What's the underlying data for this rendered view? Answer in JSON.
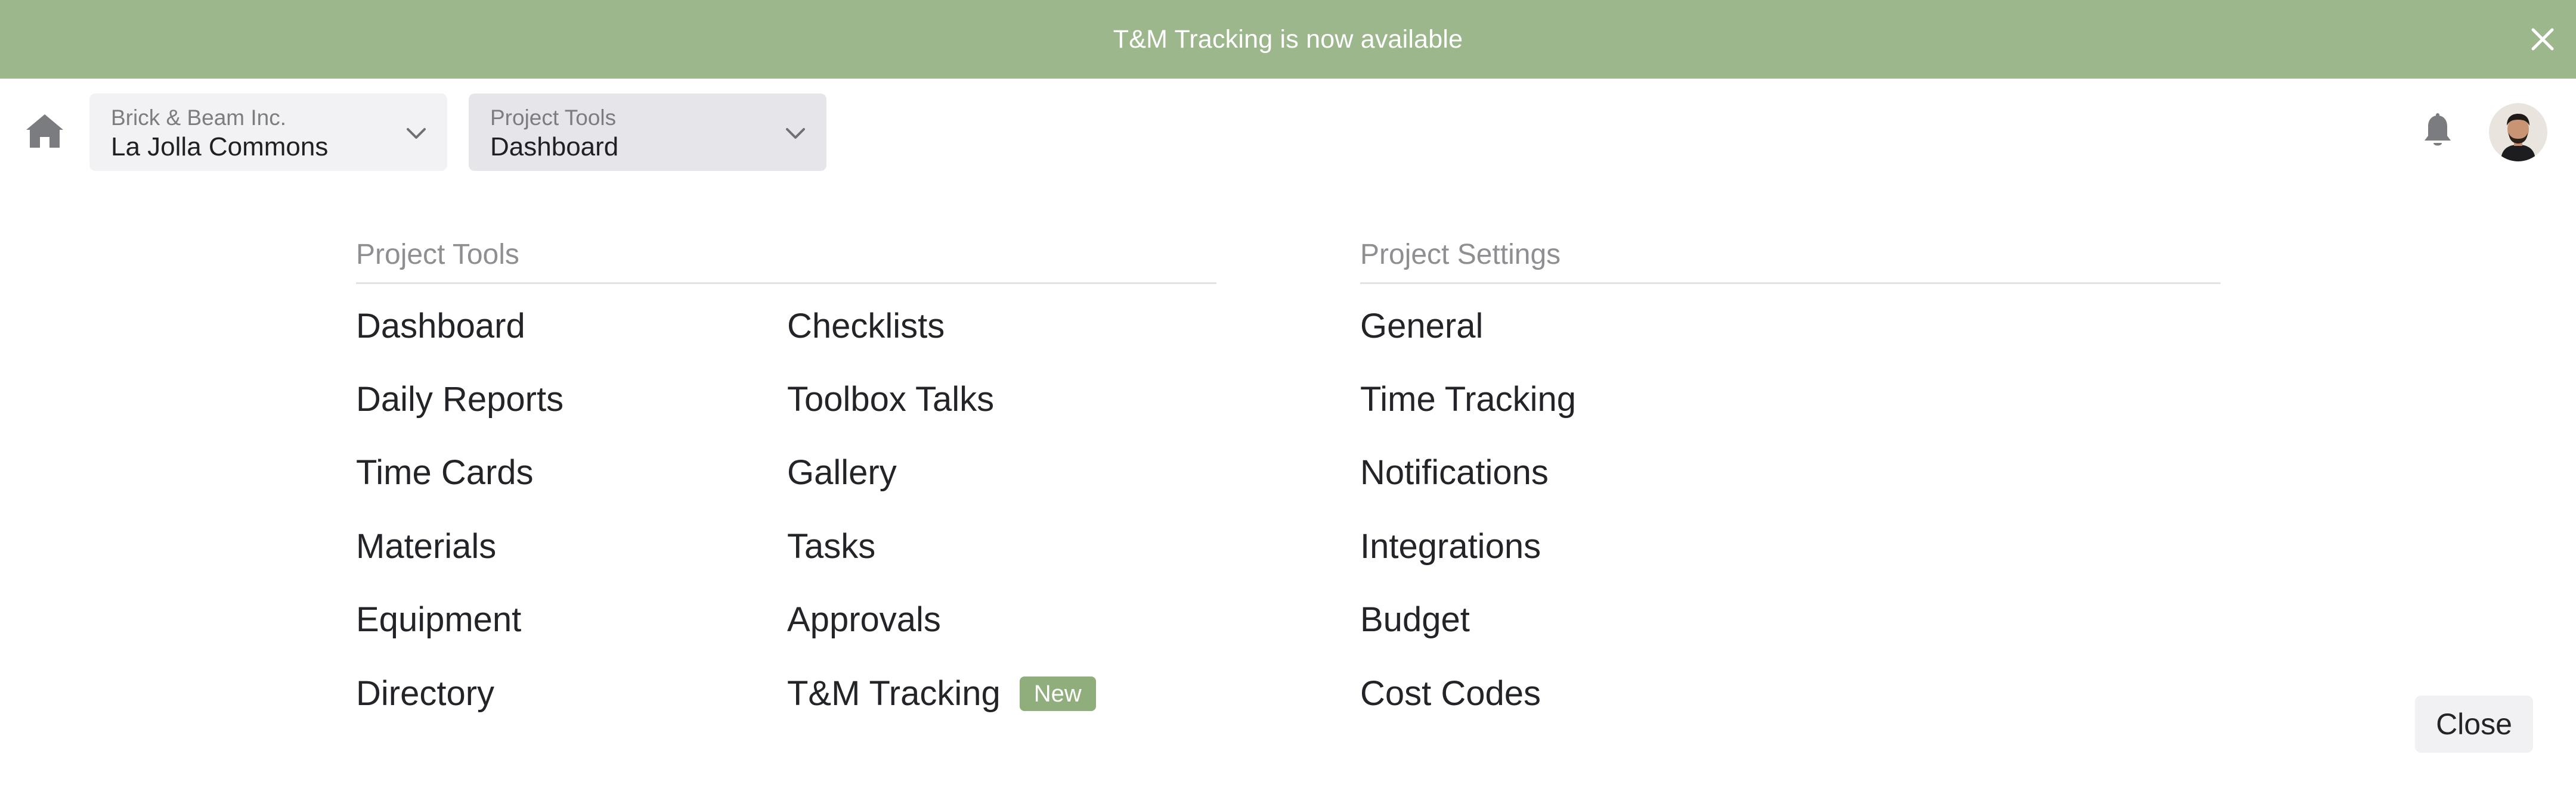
{
  "banner": {
    "message": "T&M Tracking is now available",
    "close_icon": "close-icon",
    "color": "#9db78c"
  },
  "header": {
    "home_icon": "home-icon",
    "company_picker": {
      "label": "Brick & Beam Inc.",
      "value": "La Jolla Commons",
      "icon": "chevron-down-icon"
    },
    "tool_picker": {
      "label": "Project Tools",
      "value": "Dashboard",
      "icon": "chevron-down-icon"
    },
    "notifications_icon": "bell-icon",
    "avatar_icon": "avatar"
  },
  "project_tools": {
    "title": "Project Tools",
    "column1": [
      "Dashboard",
      "Daily Reports",
      "Time Cards",
      "Materials",
      "Equipment",
      "Directory"
    ],
    "column2": [
      "Checklists",
      "Toolbox Talks",
      "Gallery",
      "Tasks",
      "Approvals",
      "T&M Tracking"
    ],
    "new_badge": "New"
  },
  "project_settings": {
    "title": "Project Settings",
    "items": [
      "General",
      "Time Tracking",
      "Notifications",
      "Integrations",
      "Budget",
      "Cost Codes"
    ]
  },
  "footer": {
    "close_label": "Close"
  },
  "colors": {
    "accent_green": "#9db78c",
    "badge_green": "#8fae7c",
    "text": "#222428",
    "muted": "#8e8f92"
  }
}
